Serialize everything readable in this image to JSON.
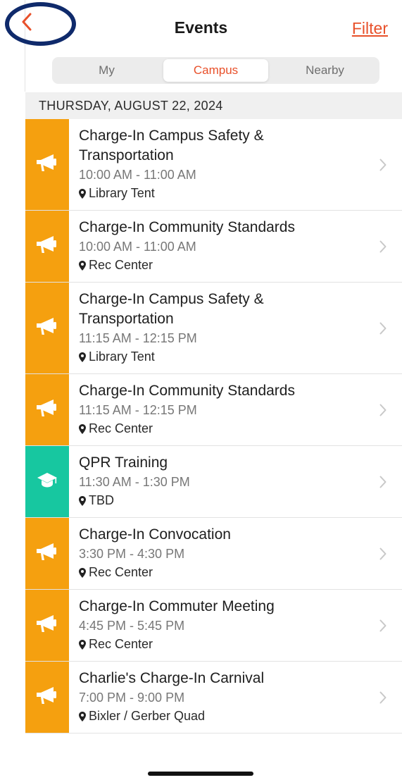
{
  "header": {
    "title": "Events",
    "filter_label": "Filter"
  },
  "tabs": [
    {
      "label": "My",
      "active": false
    },
    {
      "label": "Campus",
      "active": true
    },
    {
      "label": "Nearby",
      "active": false
    }
  ],
  "date_header": "THURSDAY, AUGUST 22, 2024",
  "colors": {
    "accent": "#e8502a",
    "announcement": "#f5a00f",
    "training": "#17c7a0",
    "highlight_ring": "#0f2a6b"
  },
  "events": [
    {
      "title": "Charge-In Campus Safety & Transportation",
      "time": "10:00 AM - 11:00 AM",
      "location": "Library Tent",
      "icon": "megaphone-icon",
      "category": "announcement"
    },
    {
      "title": "Charge-In Community Standards",
      "time": "10:00 AM - 11:00 AM",
      "location": "Rec Center",
      "icon": "megaphone-icon",
      "category": "announcement"
    },
    {
      "title": "Charge-In Campus Safety & Transportation",
      "time": "11:15 AM - 12:15 PM",
      "location": "Library Tent",
      "icon": "megaphone-icon",
      "category": "announcement"
    },
    {
      "title": "Charge-In Community Standards",
      "time": "11:15 AM - 12:15 PM",
      "location": "Rec Center",
      "icon": "megaphone-icon",
      "category": "announcement"
    },
    {
      "title": "QPR Training",
      "time": "11:30 AM - 1:30 PM",
      "location": "TBD",
      "icon": "graduation-cap-icon",
      "category": "training"
    },
    {
      "title": "Charge-In Convocation",
      "time": "3:30 PM - 4:30 PM",
      "location": "Rec Center",
      "icon": "megaphone-icon",
      "category": "announcement"
    },
    {
      "title": "Charge-In Commuter Meeting",
      "time": "4:45 PM - 5:45 PM",
      "location": "Rec Center",
      "icon": "megaphone-icon",
      "category": "announcement"
    },
    {
      "title": "Charlie's Charge-In Carnival",
      "time": "7:00 PM - 9:00 PM",
      "location": "Bixler / Gerber Quad",
      "icon": "megaphone-icon",
      "category": "announcement"
    }
  ]
}
